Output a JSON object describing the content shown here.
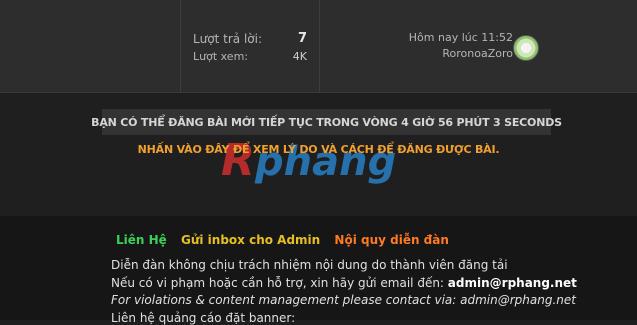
{
  "thread": {
    "replies_label": "Lượt trả lời:",
    "replies_value": "7",
    "views_label": "Lượt xem:",
    "views_value": "4K",
    "last_post_time": "Hôm nay lúc 11:52",
    "last_post_user": "RoronoaZoro"
  },
  "notice": {
    "message": "BẠN CÓ THỂ ĐĂNG BÀI MỚI TIẾP TỤC TRONG VÒNG 4 GIỜ 56 PHÚT 3 SECONDS",
    "link": "NHẤN VÀO ĐÂY ĐỂ XEM LÝ DO VÀ CÁCH ĐỂ ĐĂNG ĐƯỢC BÀI."
  },
  "watermark": {
    "text": "Rphang",
    "colors": [
      "#e03030",
      "#2a8ad8"
    ]
  },
  "footer": {
    "links": [
      "Liên Hệ",
      "Gửi inbox cho Admin",
      "Nội quy diễn đàn"
    ],
    "line1": "Diễn đàn không chịu trách nhiệm nội dung do thành viên đăng tải",
    "line2_prefix": "Nếu có vi phạm hoặc cần hỗ trợ, xin hãy gửi email đến: ",
    "line2_email": "admin@rphang.net",
    "line3": "For violations & content management please contact via: admin@rphang.net",
    "line4": "Liên hệ quảng cáo đặt banner:"
  }
}
